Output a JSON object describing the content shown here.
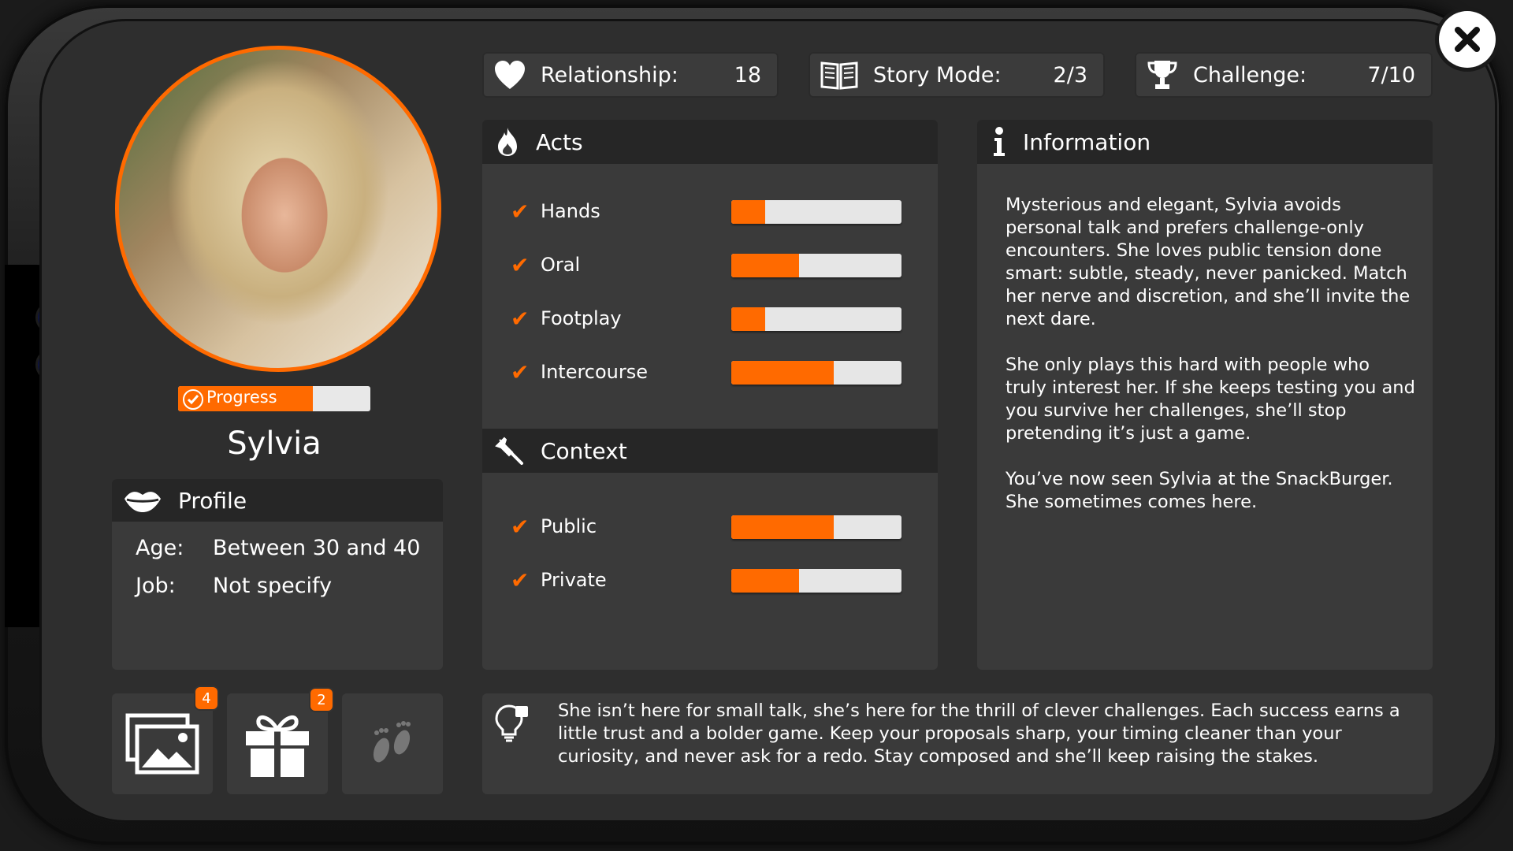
{
  "stats": {
    "relationship": {
      "label": "Relationship:",
      "value": "18"
    },
    "story_mode": {
      "label": "Story Mode:",
      "value": "2/3"
    },
    "challenge": {
      "label": "Challenge:",
      "value": "7/10"
    }
  },
  "character": {
    "name": "Sylvia",
    "progress_label": "Progress",
    "progress_fraction": 0.7
  },
  "profile": {
    "title": "Profile",
    "age_label": "Age:",
    "age_value": "Between 30 and 40",
    "job_label": "Job:",
    "job_value": "Not specify"
  },
  "acts": {
    "title": "Acts",
    "items": [
      {
        "label": "Hands",
        "level": 0.2
      },
      {
        "label": "Oral",
        "level": 0.4
      },
      {
        "label": "Footplay",
        "level": 0.2
      },
      {
        "label": "Intercourse",
        "level": 0.6
      }
    ]
  },
  "context": {
    "title": "Context",
    "items": [
      {
        "label": "Public",
        "level": 0.6
      },
      {
        "label": "Private",
        "level": 0.4
      }
    ]
  },
  "information": {
    "title": "Information",
    "text": "Mysterious and elegant, Sylvia avoids personal talk and prefers challenge-only encounters. She loves public tension done smart: subtle, steady, never panicked. Match her nerve and discretion, and she’ll invite the next dare.\n\nShe only plays this hard with people who truly interest her. If she keeps testing you and you survive her challenges, she’ll stop pretending it’s just a game.\n\nYou’ve now seen Sylvia at the SnackBurger. She sometimes comes here."
  },
  "bottom_buttons": {
    "gallery_badge": "4",
    "gifts_badge": "2"
  },
  "tip": {
    "text": "She isn’t here for small talk, she’s here for the thrill of clever challenges. Each success earns a little trust and a bolder game. Keep your proposals sharp, your timing cleaner than your curiosity, and never ask for a redo. Stay composed and she’ll keep raising the stakes."
  },
  "colors": {
    "accent": "#ff6a00",
    "panel": "#3a3a3a",
    "panel_header": "#262626",
    "bar_track": "#e6e6e6"
  },
  "icons": {
    "close": "close-icon",
    "relationship": "heart-icon",
    "story_mode": "book-icon",
    "challenge": "trophy-icon",
    "acts": "flame-icon",
    "context": "pin-icon",
    "information": "info-icon",
    "profile": "lips-icon",
    "gallery": "gallery-icon",
    "gifts": "gift-icon",
    "locked": "footprints-icon",
    "tip": "lightbulb-icon"
  }
}
